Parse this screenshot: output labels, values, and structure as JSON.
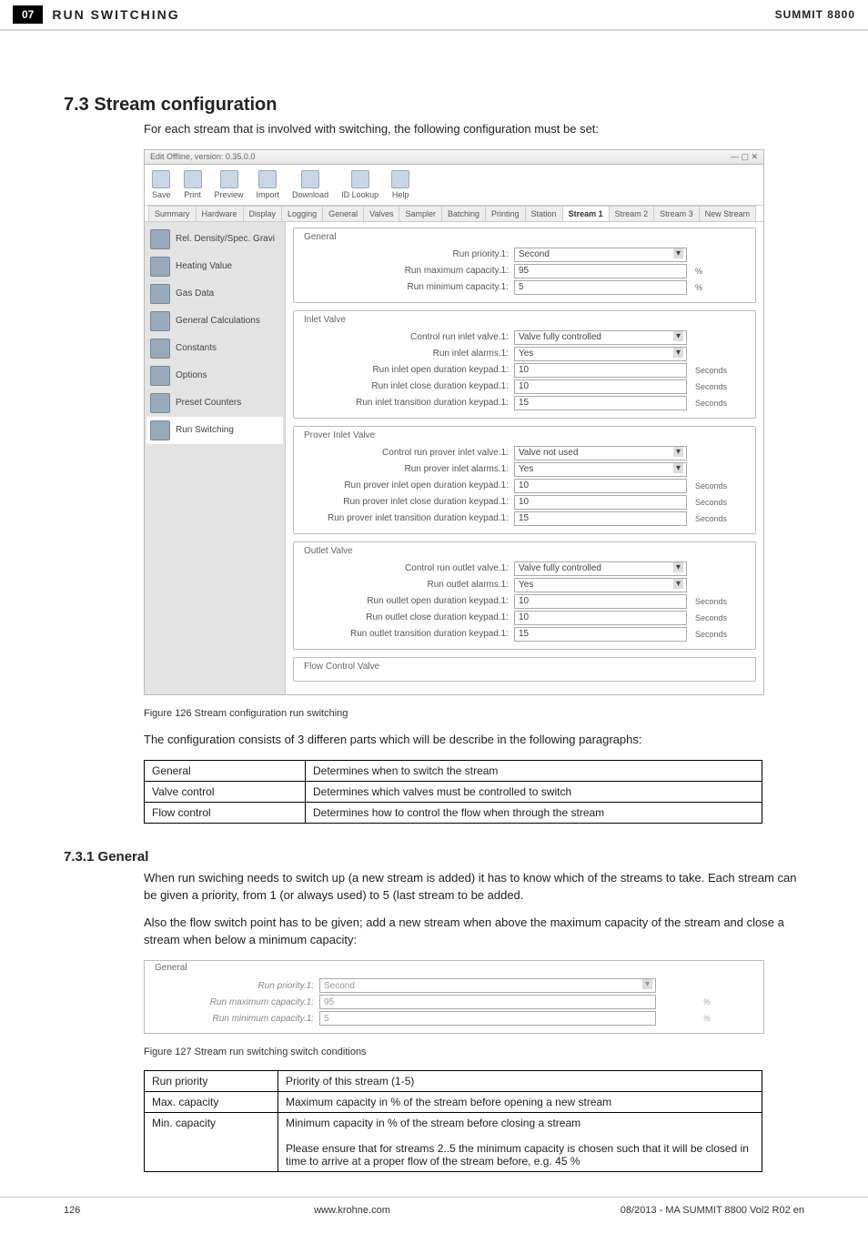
{
  "header": {
    "number": "07",
    "title": "RUN SWITCHING",
    "device": "SUMMIT 8800"
  },
  "section_73_title": "7.3 Stream configuration",
  "section_73_intro": "For each stream that is involved with switching, the following configuration must be set:",
  "editor_window": {
    "title": "Edit Offline, version: 0.35.0.0",
    "toolbar": [
      "Save",
      "Print",
      "Preview",
      "Import",
      "Download",
      "ID Lookup",
      "Help"
    ],
    "tabs": [
      "Summary",
      "Hardware",
      "Display",
      "Logging",
      "General",
      "Valves",
      "Sampler",
      "Batching",
      "Printing",
      "Station",
      "Stream 1",
      "Stream 2",
      "Stream 3",
      "New Stream"
    ],
    "active_tab": "Stream 1",
    "side_nav": [
      "Rel. Density/Spec. Gravi",
      "Heating Value",
      "Gas Data",
      "General Calculations",
      "Constants",
      "Options",
      "Preset Counters",
      "Run Switching"
    ],
    "side_nav_selected": "Run Switching",
    "groups": {
      "general": {
        "legend": "General",
        "rows": [
          {
            "label": "Run priority.1:",
            "value": "Second",
            "type": "select",
            "unit": ""
          },
          {
            "label": "Run maximum capacity.1:",
            "value": "95",
            "type": "input",
            "unit": "%"
          },
          {
            "label": "Run minimum capacity.1:",
            "value": "5",
            "type": "input",
            "unit": "%"
          }
        ]
      },
      "inlet": {
        "legend": "Inlet Valve",
        "rows": [
          {
            "label": "Control run inlet valve.1:",
            "value": "Valve fully controlled",
            "type": "select",
            "unit": ""
          },
          {
            "label": "Run inlet alarms.1:",
            "value": "Yes",
            "type": "select",
            "unit": ""
          },
          {
            "label": "Run inlet open duration keypad.1:",
            "value": "10",
            "type": "input",
            "unit": "Seconds"
          },
          {
            "label": "Run inlet close duration keypad.1:",
            "value": "10",
            "type": "input",
            "unit": "Seconds"
          },
          {
            "label": "Run inlet transition duration keypad.1:",
            "value": "15",
            "type": "input",
            "unit": "Seconds"
          }
        ]
      },
      "prover": {
        "legend": "Prover Inlet Valve",
        "rows": [
          {
            "label": "Control run prover inlet valve.1:",
            "value": "Valve not used",
            "type": "select",
            "unit": ""
          },
          {
            "label": "Run prover inlet alarms.1:",
            "value": "Yes",
            "type": "select",
            "unit": ""
          },
          {
            "label": "Run prover inlet open duration keypad.1:",
            "value": "10",
            "type": "input",
            "unit": "Seconds"
          },
          {
            "label": "Run prover inlet close duration keypad.1:",
            "value": "10",
            "type": "input",
            "unit": "Seconds"
          },
          {
            "label": "Run prover inlet transition duration keypad.1:",
            "value": "15",
            "type": "input",
            "unit": "Seconds"
          }
        ]
      },
      "outlet": {
        "legend": "Outlet Valve",
        "rows": [
          {
            "label": "Control run outlet valve.1:",
            "value": "Valve fully controlled",
            "type": "select",
            "unit": ""
          },
          {
            "label": "Run outlet alarms.1:",
            "value": "Yes",
            "type": "select",
            "unit": ""
          },
          {
            "label": "Run outlet open duration keypad.1:",
            "value": "10",
            "type": "input",
            "unit": "Seconds"
          },
          {
            "label": "Run outlet close duration keypad.1:",
            "value": "10",
            "type": "input",
            "unit": "Seconds"
          },
          {
            "label": "Run outlet transition duration keypad.1:",
            "value": "15",
            "type": "input",
            "unit": "Seconds"
          }
        ]
      },
      "flow": {
        "legend": "Flow Control Valve"
      }
    }
  },
  "figure126_caption": "Figure 126    Stream configuration run switching",
  "section_73_after_fig": "The configuration consists of 3 differen parts which will be describe in the following paragraphs:",
  "table_parts": [
    {
      "name": "General",
      "desc": "Determines when to switch the stream"
    },
    {
      "name": "Valve control",
      "desc": "Determines which valves must be controlled to switch"
    },
    {
      "name": "Flow control",
      "desc": "Determines how to control the flow when through the stream"
    }
  ],
  "section_731_title": "7.3.1 General",
  "section_731_p1": "When run swiching needs to switch up (a new stream is added) it has to know which of the streams to take. Each stream can be given a priority, from 1 (or always used)  to 5 (last stream to be added.",
  "section_731_p2": "Also the flow switch point has to be given; add a new stream when above the maximum capacity of the stream and close a stream when below a minimum capacity:",
  "general_screenshot": {
    "legend": "General",
    "rows": [
      {
        "label": "Run priority.1:",
        "value": "Second",
        "type": "select",
        "unit": ""
      },
      {
        "label": "Run maximum capacity.1:",
        "value": "95",
        "type": "input",
        "unit": "%"
      },
      {
        "label": "Run minimum capacity.1:",
        "value": "5",
        "type": "input",
        "unit": "%"
      }
    ]
  },
  "figure127_caption": "Figure 127    Stream run switching switch conditions",
  "table_general": [
    {
      "name": "Run priority",
      "desc": "Priority of this stream (1-5)"
    },
    {
      "name": "Max. capacity",
      "desc": "Maximum capacity in % of the stream before opening a new stream"
    },
    {
      "name": "Min. capacity",
      "desc": "Minimum capacity in % of the stream before closing a stream\n\nPlease ensure that for streams 2..5 the minimum capacity is chosen such that it will be closed in time to arrive at a proper flow of the stream before, e.g. 45 %"
    }
  ],
  "footer": {
    "page": "126",
    "url": "www.krohne.com",
    "docid": "08/2013 - MA SUMMIT 8800 Vol2 R02 en"
  }
}
